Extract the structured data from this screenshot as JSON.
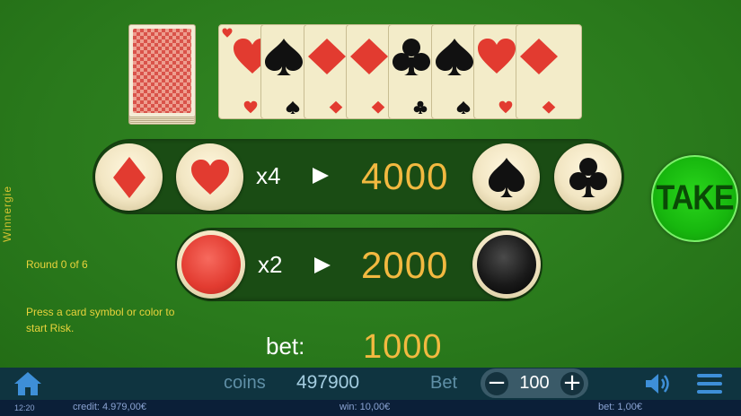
{
  "brand": "Winnergie",
  "status": {
    "round": "Round 0 of 6",
    "hint": "Press a card symbol or color to start Risk."
  },
  "history_cards": [
    {
      "suit": "hearts",
      "color": "#e23b30"
    },
    {
      "suit": "spades",
      "color": "#111111"
    },
    {
      "suit": "diamonds",
      "color": "#e23b30"
    },
    {
      "suit": "diamonds",
      "color": "#e23b30"
    },
    {
      "suit": "clubs",
      "color": "#111111"
    },
    {
      "suit": "spades",
      "color": "#111111"
    },
    {
      "suit": "hearts",
      "color": "#e23b30"
    },
    {
      "suit": "diamonds",
      "color": "#e23b30"
    }
  ],
  "suit_row": {
    "multiplier": "x4",
    "win": "4000",
    "buttons": [
      "diamonds-icon",
      "hearts-icon",
      "spades-icon",
      "clubs-icon"
    ]
  },
  "color_row": {
    "multiplier": "x2",
    "win": "2000",
    "buttons": [
      "red-color-icon",
      "black-color-icon"
    ]
  },
  "take_label": "TAKE",
  "bet": {
    "label": "bet:",
    "value": "1000"
  },
  "toolbar": {
    "coins_label": "coins",
    "coins_value": "497900",
    "bet_label": "Bet",
    "bet_step_value": "100",
    "minus": "−",
    "plus": "+"
  },
  "statusbar": {
    "time": "12:20",
    "credit": "credit: 4.979,00€",
    "win": "win: 10,00€",
    "bet": "bet: 1,00€"
  },
  "colors": {
    "felt": "#2d7d1f",
    "panel": "#1a4c14",
    "gold": "#f2b940",
    "red": "#e23b30",
    "take_green": "#17b70e",
    "toolbar": "#0f3440"
  }
}
